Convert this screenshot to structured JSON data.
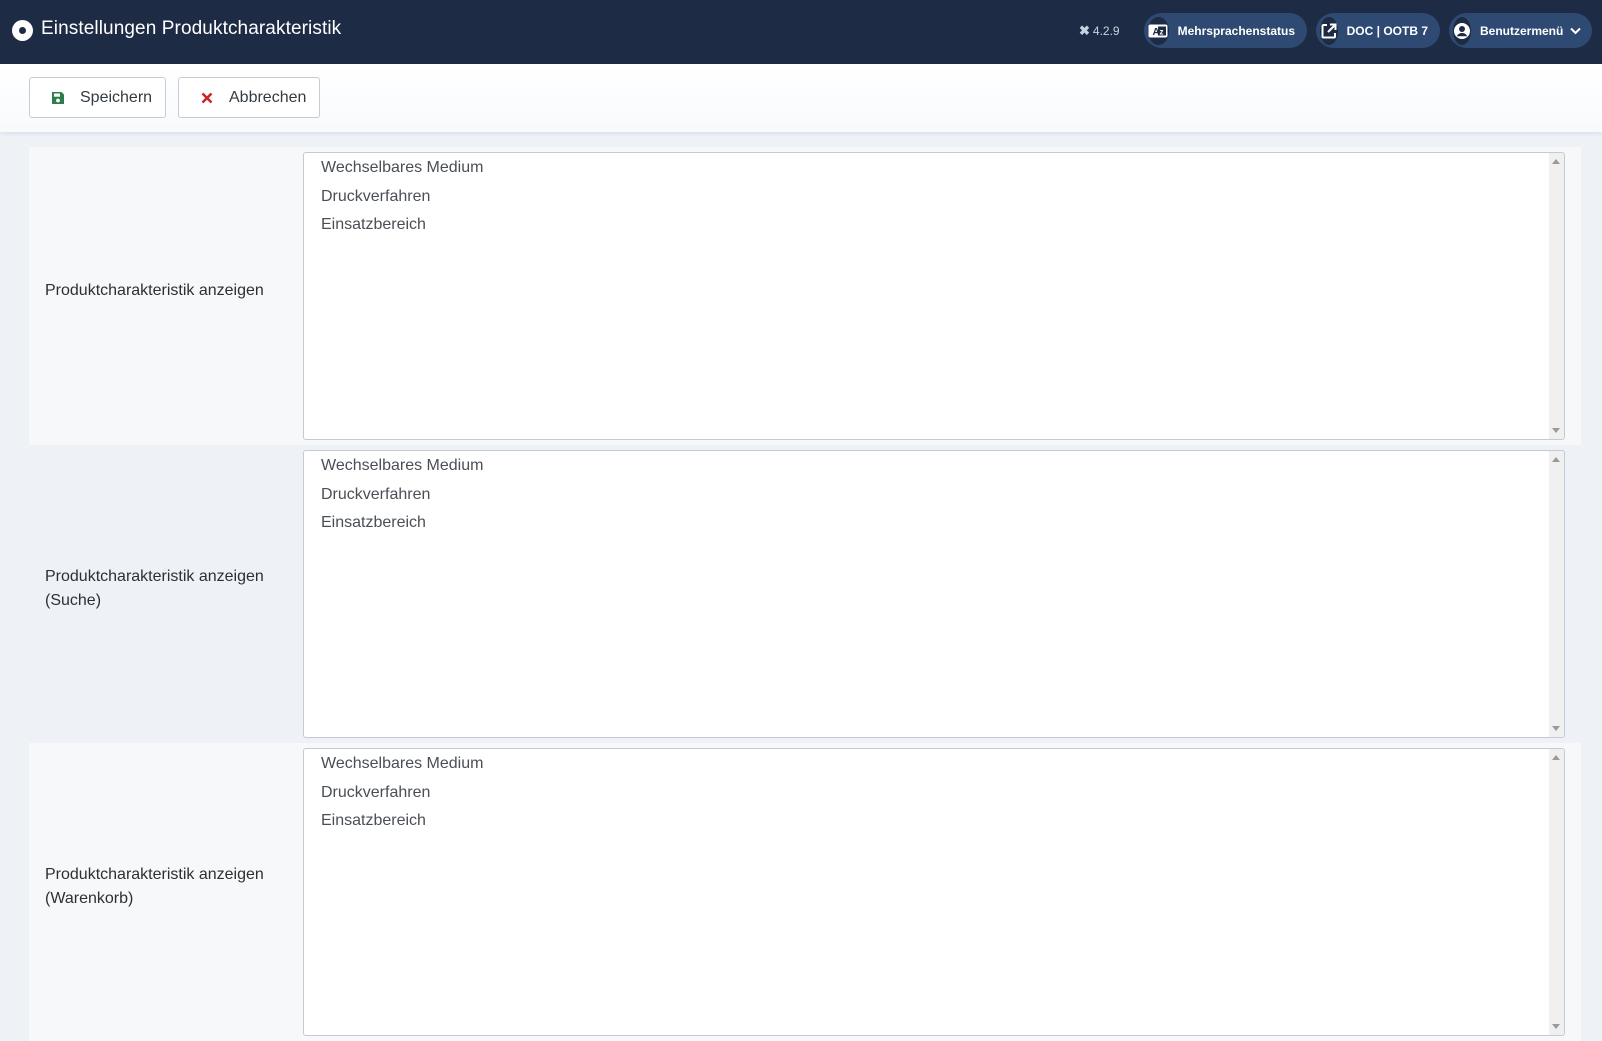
{
  "header": {
    "title": "Einstellungen Produktcharakteristik",
    "version": "4.2.9",
    "pills": {
      "language_status": "Mehrsprachenstatus",
      "site_link": "DOC | OOTB 7",
      "user_menu": "Benutzermenü"
    }
  },
  "toolbar": {
    "save_label": "Speichern",
    "cancel_label": "Abbrechen"
  },
  "fields": [
    {
      "label_line1": "Produktcharakteristik anzeigen",
      "label_line2": "",
      "options": [
        "Wechselbares Medium",
        "Druckverfahren",
        "Einsatzbereich"
      ]
    },
    {
      "label_line1": "Produktcharakteristik anzeigen",
      "label_line2": "(Suche)",
      "options": [
        "Wechselbares Medium",
        "Druckverfahren",
        "Einsatzbereich"
      ]
    },
    {
      "label_line1": "Produktcharakteristik anzeigen",
      "label_line2": "(Warenkorb)",
      "options": [
        "Wechselbares Medium",
        "Druckverfahren",
        "Einsatzbereich"
      ]
    }
  ],
  "colors": {
    "header_bg": "#1d2b44",
    "pill_bg": "#2e4a72",
    "save_icon": "#2f7d4a",
    "cancel_icon": "#c62828"
  },
  "icons": {
    "title": "circle-dot-icon",
    "version": "joomla-icon",
    "language": "language-icon",
    "external": "external-link-icon",
    "user": "user-circle-icon",
    "save": "floppy-disk-icon",
    "cancel": "close-icon"
  }
}
